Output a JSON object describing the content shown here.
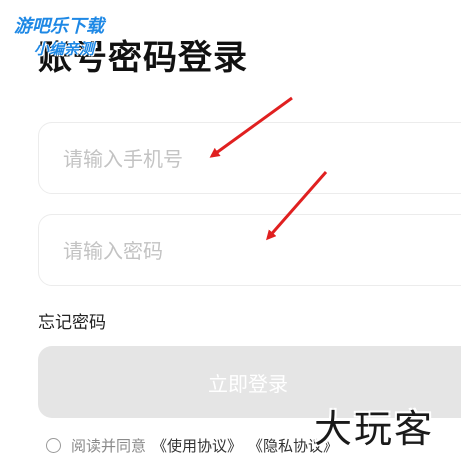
{
  "page": {
    "title": "账号密码登录"
  },
  "watermark_top": {
    "line1": "游吧乐下载",
    "line2": "小编亲测"
  },
  "phone_field": {
    "placeholder": "请输入手机号",
    "value": ""
  },
  "password_field": {
    "placeholder": "请输入密码",
    "value": ""
  },
  "forgot_password": "忘记密码",
  "login_button": "立即登录",
  "agreement": {
    "prefix": "阅读并同意",
    "terms_link": "《使用协议》",
    "privacy_link": "《隐私协议》",
    "checked": false
  },
  "watermark_bottom": "大玩客",
  "colors": {
    "annotation_arrow": "#e02020",
    "login_button_disabled": "#e5e5e5",
    "watermark_blue": "#1e88e5"
  },
  "icons": [
    "radio-unchecked-icon",
    "annotation-arrow-icon"
  ]
}
